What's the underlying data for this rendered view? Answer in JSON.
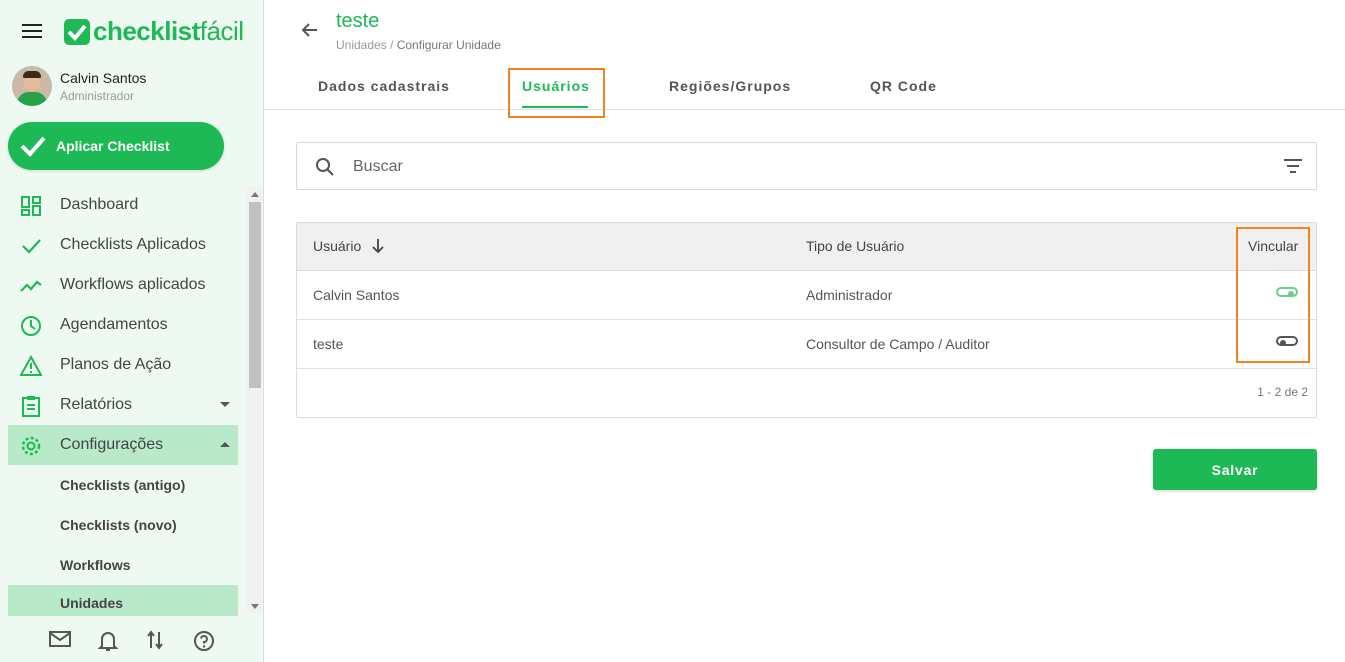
{
  "brand": {
    "name_bold": "checklist",
    "name_light": "fácil",
    "color": "#1db954"
  },
  "profile": {
    "name": "Calvin Santos",
    "role": "Administrador"
  },
  "sidebar": {
    "apply_label": "Aplicar Checklist",
    "items": [
      {
        "label": "Dashboard",
        "icon": "dashboard-icon"
      },
      {
        "label": "Checklists Aplicados",
        "icon": "check-icon"
      },
      {
        "label": "Workflows aplicados",
        "icon": "trend-icon"
      },
      {
        "label": "Agendamentos",
        "icon": "clock-icon"
      },
      {
        "label": "Planos de Ação",
        "icon": "warning-icon"
      },
      {
        "label": "Relatórios",
        "icon": "clipboard-icon"
      },
      {
        "label": "Configurações",
        "icon": "gear-icon"
      }
    ],
    "subitems": [
      {
        "label": "Checklists (antigo)"
      },
      {
        "label": "Checklists (novo)"
      },
      {
        "label": "Workflows"
      },
      {
        "label": "Unidades"
      }
    ]
  },
  "header": {
    "title": "teste",
    "breadcrumb_parent": "Unidades /",
    "breadcrumb_current": "Configurar Unidade"
  },
  "tabs": [
    {
      "label": "Dados cadastrais"
    },
    {
      "label": "Usuários",
      "active": true
    },
    {
      "label": "Regiões/Grupos"
    },
    {
      "label": "QR Code"
    }
  ],
  "search": {
    "placeholder": "Buscar"
  },
  "table": {
    "columns": [
      "Usuário",
      "Tipo de Usuário",
      "Vincular"
    ],
    "rows": [
      {
        "user": "Calvin Santos",
        "type": "Administrador",
        "linked": true
      },
      {
        "user": "teste",
        "type": "Consultor de Campo / Auditor",
        "linked": false
      }
    ],
    "pagination": "1 - 2 de 2"
  },
  "actions": {
    "save_label": "Salvar"
  },
  "colors": {
    "accent": "#1db954",
    "highlight": "#f0841d",
    "active_bg": "#b8e9c8",
    "sidebar_bg": "#eef9f1"
  }
}
